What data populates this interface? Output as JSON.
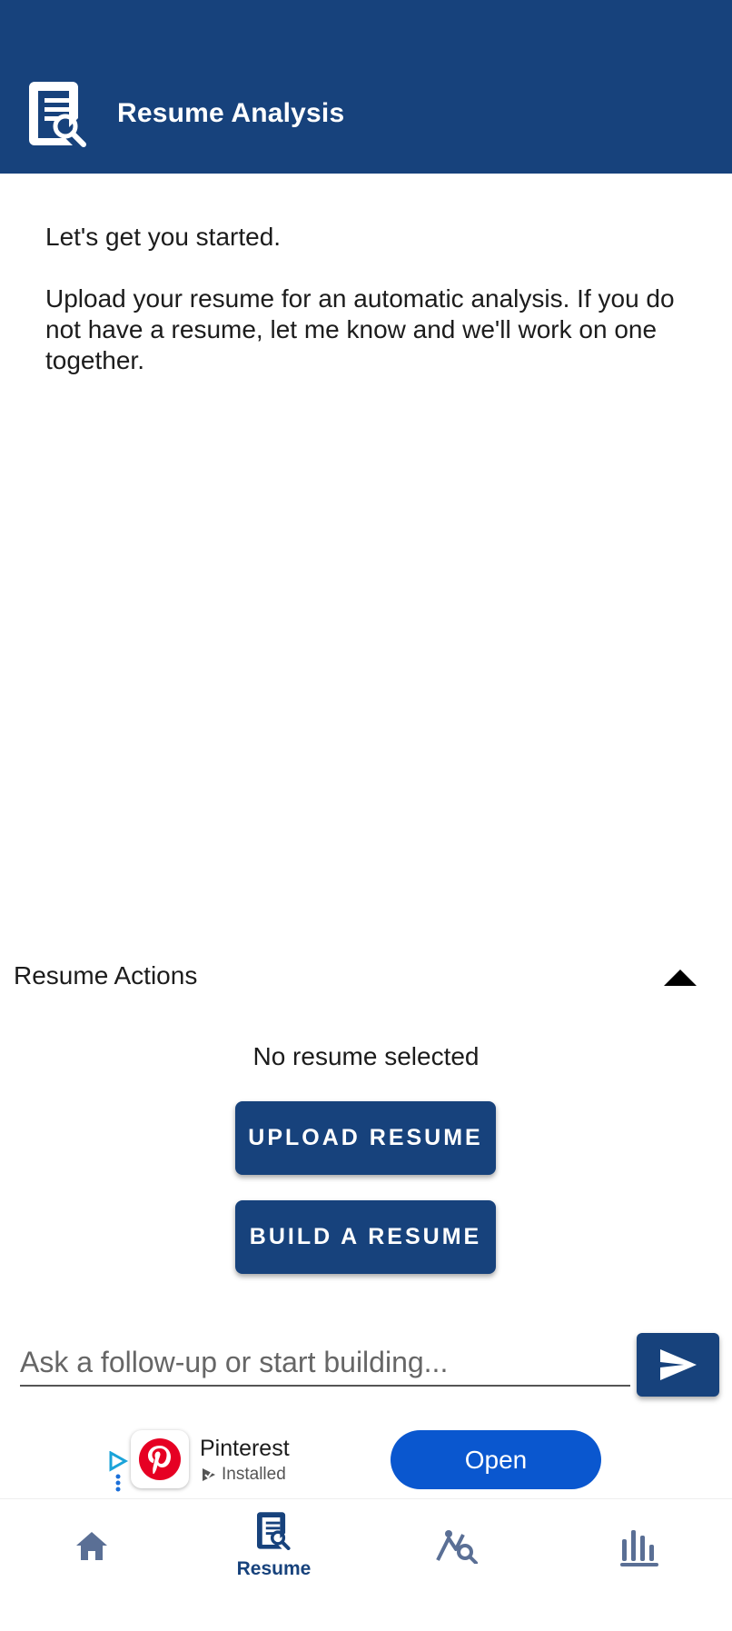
{
  "app_bar": {
    "title": "Resume Analysis",
    "icon": "resume-search-icon",
    "background": "#17427c"
  },
  "message": {
    "greeting": "Let's get you started.",
    "body": "Upload your resume for an automatic analysis. If you do not have a resume, let me know and we'll work on one together."
  },
  "resume_actions": {
    "title": "Resume Actions",
    "toggle_icon": "caret-up-icon",
    "status": "No resume selected",
    "upload_label": "UPLOAD RESUME",
    "build_label": "BUILD A RESUME"
  },
  "chat": {
    "placeholder": "Ask a follow-up or start building...",
    "send_icon": "send-icon"
  },
  "ad": {
    "app_name": "Pinterest",
    "status": "Installed",
    "open_label": "Open",
    "accent": "#0a57cf"
  },
  "bottom_nav": {
    "items": [
      {
        "icon": "home-icon",
        "label": ""
      },
      {
        "icon": "resume-icon",
        "label": "Resume",
        "active": true
      },
      {
        "icon": "career-path-icon",
        "label": ""
      },
      {
        "icon": "stats-icon",
        "label": ""
      }
    ],
    "active_color": "#17427c",
    "inactive_color": "#5a6f95"
  }
}
